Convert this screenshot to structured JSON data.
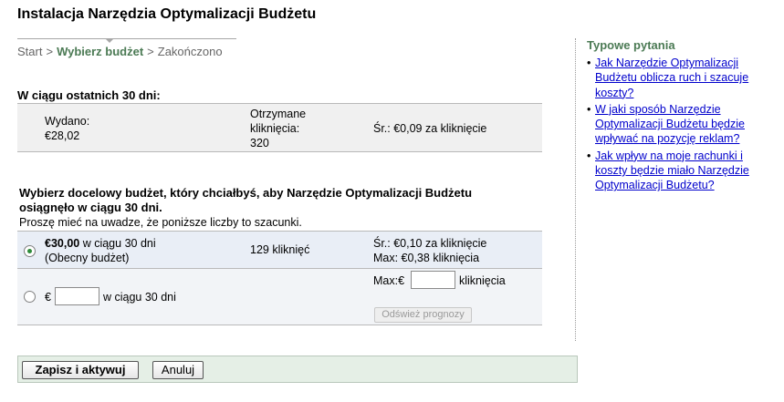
{
  "page": {
    "title": "Instalacja Narzędzia Optymalizacji Budżetu"
  },
  "breadcrumb": {
    "steps": [
      "Start",
      "Wybierz budżet",
      "Zakończono"
    ],
    "separator": ">"
  },
  "stats": {
    "heading": "W ciągu ostatnich 30 dni:",
    "spent_label": "Wydano:",
    "spent_value": "€28,02",
    "clicks_label_1": "Otrzymane",
    "clicks_label_2": "kliknięcia:",
    "clicks_value": "320",
    "avg": "Śr.: €0,09 za kliknięcie"
  },
  "budget": {
    "question_1": "Wybierz docelowy budżet, który chciałbyś, aby Narzędzie Optymalizacji Budżetu",
    "question_2": "osiągnęło w ciągu 30 dni.",
    "note": "Proszę mieć na uwadze, że poniższe liczby to szacunki.",
    "option1": {
      "amount": "€30,00",
      "period": " w ciągu 30 dni",
      "current": "(Obecny budżet)",
      "clicks": "129 kliknięć",
      "avg": "Śr.: €0,10 za kliknięcie",
      "max": "Max: €0,38 kliknięcia",
      "selected": true
    },
    "option2": {
      "currency": "€",
      "amount_value": "",
      "period": "w ciągu 30 dni",
      "max_label": "Max:€",
      "max_value": "",
      "max_unit": "kliknięcia",
      "refresh_label": "Odśwież prognozy",
      "selected": false
    }
  },
  "actions": {
    "save_label": "Zapisz i aktywuj",
    "cancel_label": "Anuluj"
  },
  "faq": {
    "title": "Typowe pytania",
    "items": [
      "Jak Narzędzie Optymalizacji Budżetu oblicza ruch i szacuje koszty?",
      "W jaki sposób Narzędzie Optymalizacji Budżetu będzie wpływać na pozycję reklam?",
      "Jak wpływ na moje rachunki i koszty będzie miało Narzędzie Optymalizacji Budżetu?"
    ]
  },
  "colors": {
    "accent_green": "#4b7a54",
    "link_blue": "#0000cc",
    "action_bar_bg": "#e5efe6"
  }
}
